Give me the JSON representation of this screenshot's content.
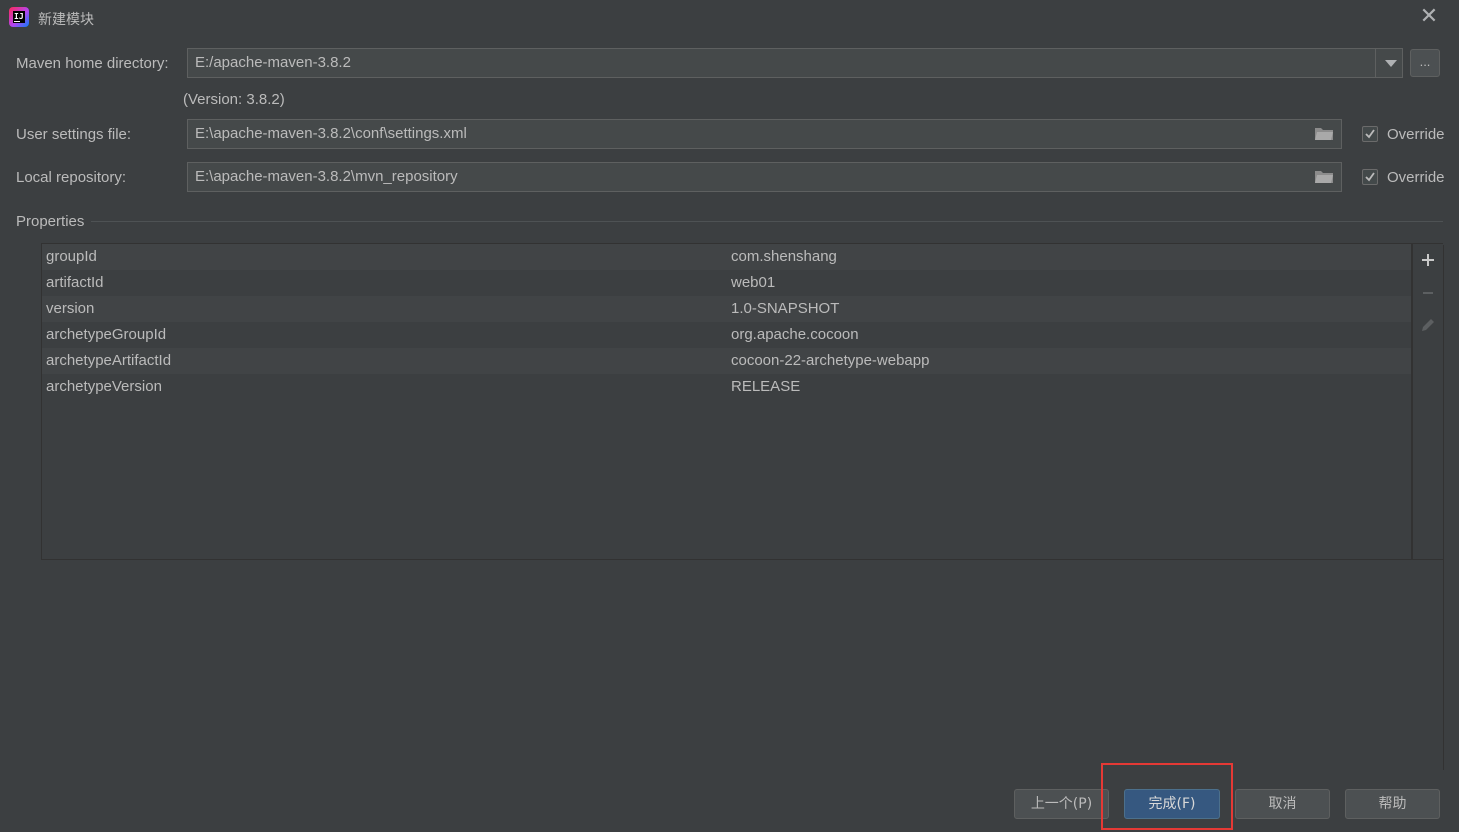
{
  "window": {
    "title": "新建模块",
    "close_icon": "close-icon"
  },
  "maven_home": {
    "label": "Maven home directory:",
    "value": "E:/apache-maven-3.8.2",
    "browse_label": "...",
    "version_text": "(Version: 3.8.2)"
  },
  "user_settings": {
    "label": "User settings file:",
    "value": "E:\\apache-maven-3.8.2\\conf\\settings.xml",
    "override_label": "Override",
    "override_checked": true
  },
  "local_repo": {
    "label": "Local repository:",
    "value": "E:\\apache-maven-3.8.2\\mvn_repository",
    "override_label": "Override",
    "override_checked": true
  },
  "properties": {
    "section_label": "Properties",
    "rows": [
      {
        "key": "groupId",
        "value": "com.shenshang"
      },
      {
        "key": "artifactId",
        "value": "web01"
      },
      {
        "key": "version",
        "value": "1.0-SNAPSHOT"
      },
      {
        "key": "archetypeGroupId",
        "value": "org.apache.cocoon"
      },
      {
        "key": "archetypeArtifactId",
        "value": "cocoon-22-archetype-webapp"
      },
      {
        "key": "archetypeVersion",
        "value": "RELEASE"
      }
    ],
    "toolbar": [
      "add-icon",
      "remove-icon",
      "edit-icon"
    ]
  },
  "buttons": {
    "previous": "上一个(P)",
    "finish": "完成(F)",
    "cancel": "取消",
    "help": "帮助"
  },
  "colors": {
    "background": "#3c3f41",
    "field": "#45494a",
    "primary_button": "#365880",
    "highlight": "#e53935"
  }
}
